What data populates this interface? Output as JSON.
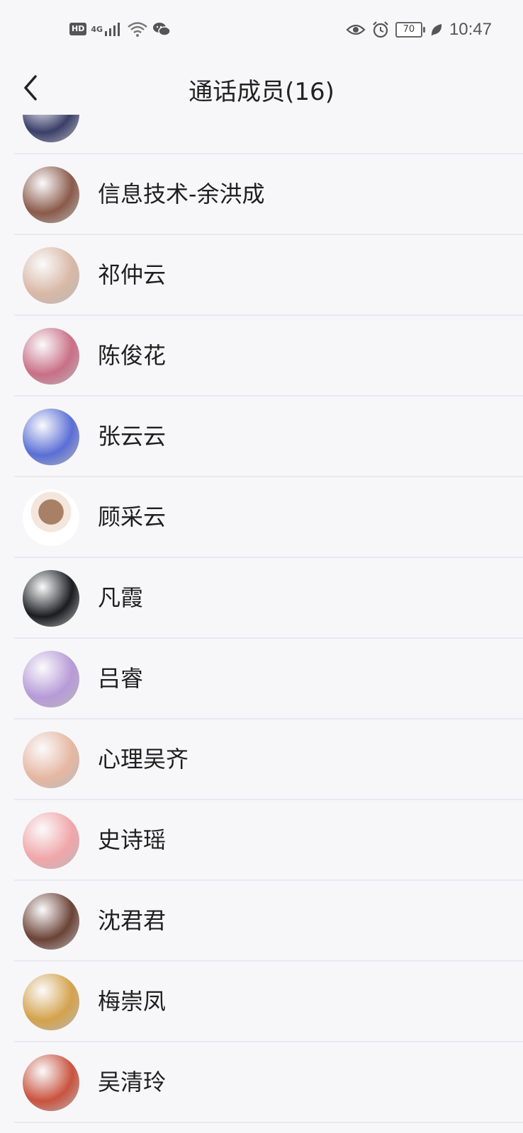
{
  "status_bar": {
    "hd": "HD",
    "network": "4G",
    "battery": "70",
    "time": "10:47",
    "icons": [
      "signal-icon",
      "wifi-icon",
      "wechat-icon",
      "eye-icon",
      "alarm-icon",
      "leaf-icon"
    ]
  },
  "header": {
    "back_icon": "chevron-left-icon",
    "title": "通话成员(16)"
  },
  "members": [
    {
      "name": "",
      "avatar_color": "#3a3f6a"
    },
    {
      "name": "信息技术-余洪成",
      "avatar_color": "#8a5a4a"
    },
    {
      "name": "祁仲云",
      "avatar_color": "#d9b8a6"
    },
    {
      "name": "陈俊花",
      "avatar_color": "#c96f86"
    },
    {
      "name": "张云云",
      "avatar_color": "#5a6fd6"
    },
    {
      "name": "顾采云",
      "avatar_color": "#ffffff"
    },
    {
      "name": "凡霞",
      "avatar_color": "#1a1d20"
    },
    {
      "name": "吕睿",
      "avatar_color": "#b79ad8"
    },
    {
      "name": "心理吴齐",
      "avatar_color": "#e6b7a2"
    },
    {
      "name": "史诗瑶",
      "avatar_color": "#f1a6a9"
    },
    {
      "name": "沈君君",
      "avatar_color": "#6b4236"
    },
    {
      "name": "梅崇凤",
      "avatar_color": "#d4a24c"
    },
    {
      "name": "吴清玲",
      "avatar_color": "#c9533e"
    }
  ]
}
